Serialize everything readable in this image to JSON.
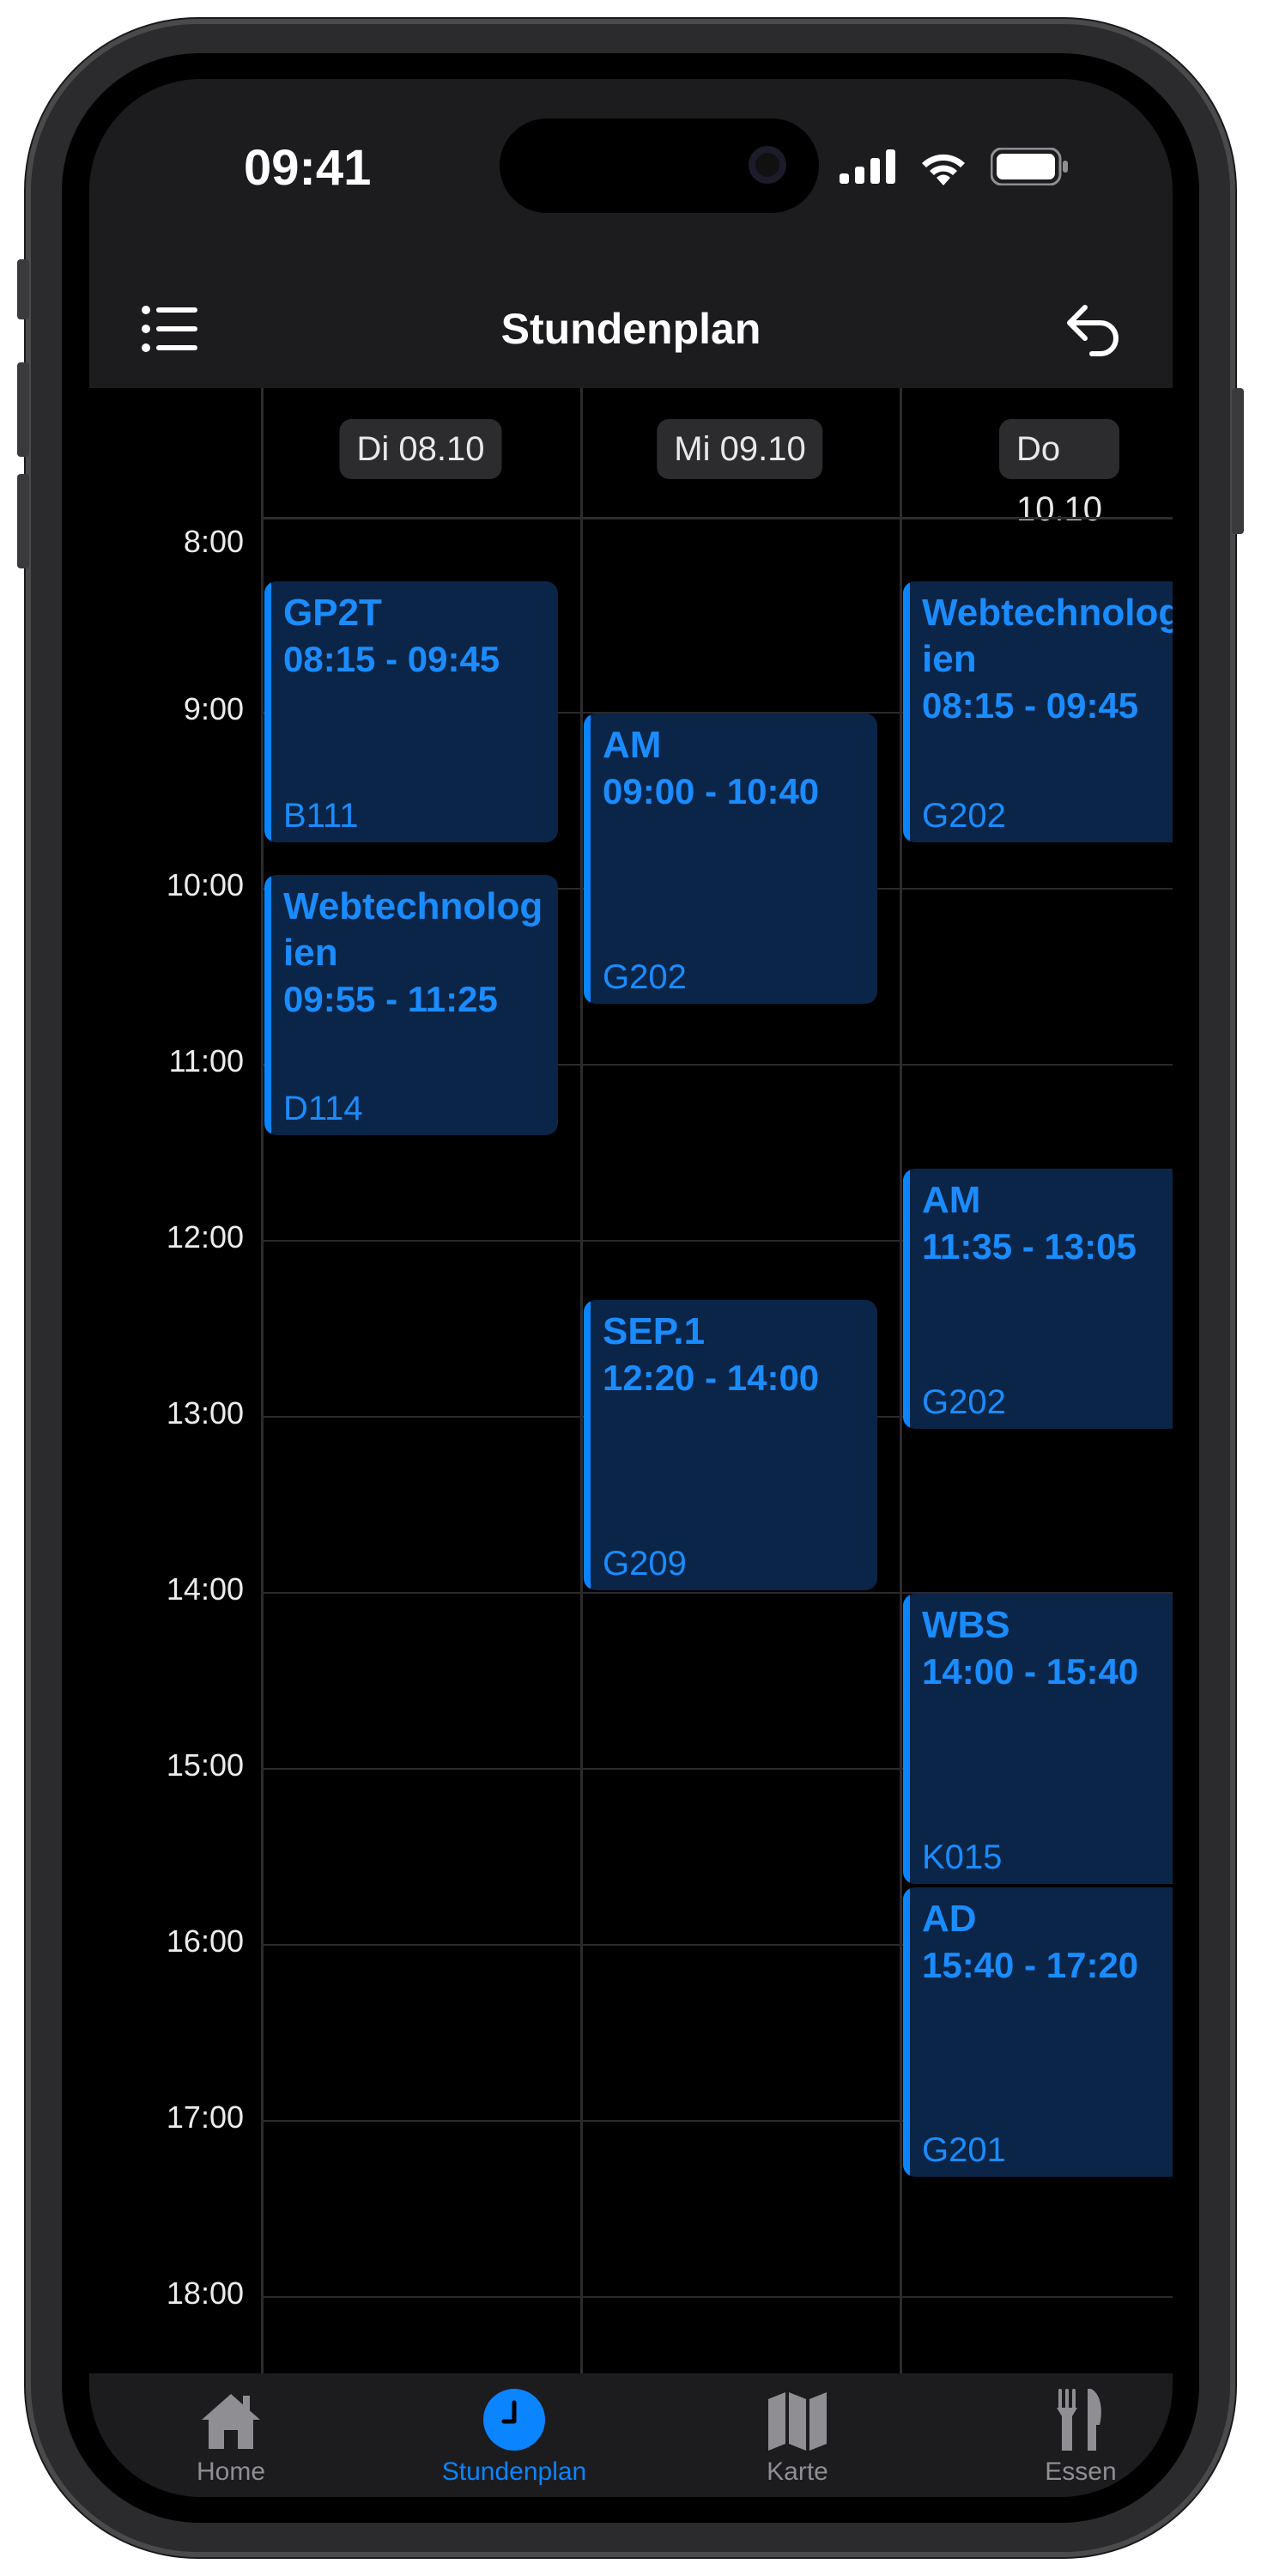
{
  "status_bar": {
    "time": "09:41"
  },
  "nav": {
    "title": "Stundenplan",
    "menu_icon": "list-icon",
    "back_icon": "undo-arrow-icon"
  },
  "days": [
    {
      "label": "Di 08.10"
    },
    {
      "label": "Mi 09.10"
    },
    {
      "label": "Do 10.10"
    }
  ],
  "hours": [
    "8:00",
    "9:00",
    "10:00",
    "11:00",
    "12:00",
    "13:00",
    "14:00",
    "15:00",
    "16:00",
    "17:00",
    "18:00"
  ],
  "events": [
    {
      "day": 0,
      "title": "GP2T",
      "time": "08:15 - 09:45",
      "room": "B111"
    },
    {
      "day": 0,
      "title": "Webtechnologien",
      "time": "09:55 - 11:25",
      "room": "D114"
    },
    {
      "day": 1,
      "title": "AM",
      "time": "09:00 - 10:40",
      "room": "G202"
    },
    {
      "day": 1,
      "title": "SEP.1",
      "time": "12:20 - 14:00",
      "room": "G209"
    },
    {
      "day": 2,
      "title": "Webtechnologien",
      "time": "08:15 - 09:45",
      "room": "G202"
    },
    {
      "day": 2,
      "title": "AM",
      "time": "11:35 - 13:05",
      "room": "G202"
    },
    {
      "day": 2,
      "title": "WBS",
      "time": "14:00 - 15:40",
      "room": "K015"
    },
    {
      "day": 2,
      "title": "AD",
      "time": "15:40 - 17:20",
      "room": "G201"
    }
  ],
  "tabs": [
    {
      "label": "Home",
      "icon": "house-icon",
      "active": false
    },
    {
      "label": "Stundenplan",
      "icon": "clock-icon",
      "active": true
    },
    {
      "label": "Karte",
      "icon": "map-icon",
      "active": false
    },
    {
      "label": "Essen",
      "icon": "fork-knife-icon",
      "active": false
    }
  ],
  "colors": {
    "accent": "#0a84ff",
    "event_bg": "#0a2547",
    "background": "#000000",
    "bar_bg": "#1c1c1e"
  }
}
